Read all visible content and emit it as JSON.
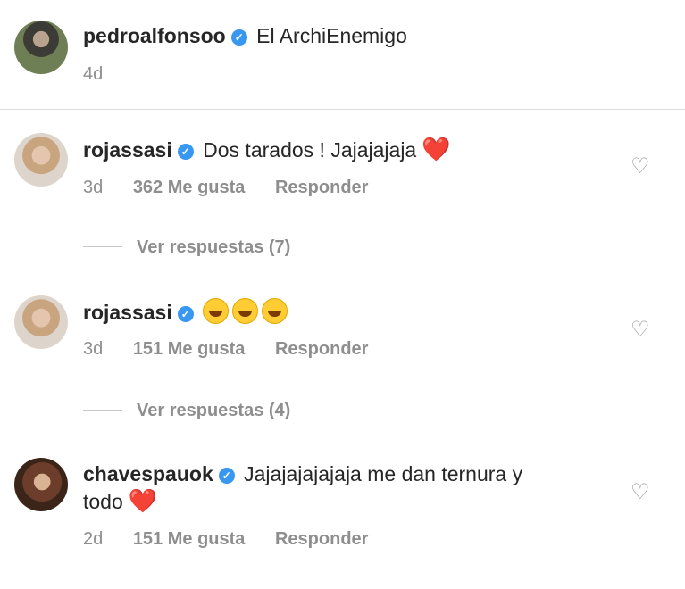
{
  "post": {
    "username": "pedroalfonsoo",
    "caption": "El ArchiEnemigo",
    "time": "4d"
  },
  "comments": [
    {
      "username": "rojassasi",
      "text": "Dos tarados ! Jajajajaja",
      "emoji": "❤️",
      "time": "3d",
      "likes": "362 Me gusta",
      "reply": "Responder",
      "view_replies": "Ver respuestas (7)"
    },
    {
      "username": "rojassasi",
      "text": "",
      "emoji": "😂😂😂",
      "time": "3d",
      "likes": "151 Me gusta",
      "reply": "Responder",
      "view_replies": "Ver respuestas (4)"
    },
    {
      "username": "chavespauok",
      "text": "Jajajajajajaja me dan ternura y",
      "text_line2": "todo",
      "emoji": "❤️",
      "time": "2d",
      "likes": "151 Me gusta",
      "reply": "Responder"
    }
  ],
  "icons": {
    "verified": "verified-badge-icon",
    "like": "heart-outline-icon"
  }
}
